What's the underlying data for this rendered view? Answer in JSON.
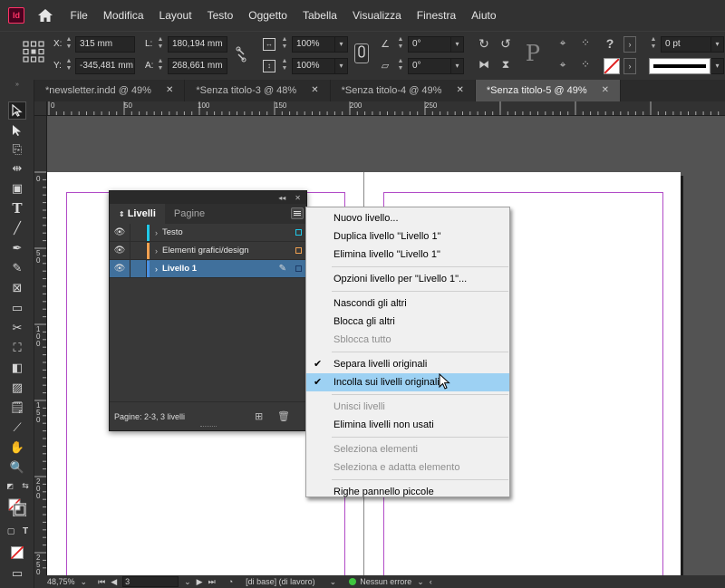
{
  "app": {
    "logo_text": "Id"
  },
  "menubar": {
    "items": [
      "File",
      "Modifica",
      "Layout",
      "Testo",
      "Oggetto",
      "Tabella",
      "Visualizza",
      "Finestra",
      "Aiuto"
    ]
  },
  "controlbar": {
    "x_label": "X:",
    "x_value": "315 mm",
    "y_label": "Y:",
    "y_value": "-345,481 mm",
    "l_label": "L:",
    "l_value": "180,194 mm",
    "a_label": "A:",
    "a_value": "268,661 mm",
    "scale_x": "100%",
    "scale_y": "100%",
    "angle_rotate": "0°",
    "angle_shear": "0°",
    "stroke_weight": "0 pt"
  },
  "tabs": [
    {
      "label": "*newsletter.indd @ 49%",
      "close": "✕",
      "active": false
    },
    {
      "label": "*Senza titolo-3 @ 48%",
      "close": "✕",
      "active": false
    },
    {
      "label": "*Senza titolo-4 @ 49%",
      "close": "✕",
      "active": false
    },
    {
      "label": "*Senza titolo-5 @ 49%",
      "close": "✕",
      "active": true
    }
  ],
  "ruler_h": [
    "0",
    "50",
    "100",
    "150",
    "200",
    "250"
  ],
  "ruler_v": [
    "0",
    "50",
    "100",
    "150",
    "200",
    "250"
  ],
  "layers_panel": {
    "tabs": [
      "Livelli",
      "Pagine"
    ],
    "layers": [
      {
        "name": "Testo",
        "color": "#20c8e8",
        "selected": false
      },
      {
        "name": "Elementi grafici/design",
        "color": "#f0a050",
        "selected": false
      },
      {
        "name": "Livello 1",
        "color": "#4a90e2",
        "selected": true
      }
    ],
    "footer_text": "Pagine: 2-3, 3 livelli"
  },
  "context_menu": {
    "items": [
      {
        "label": "Nuovo livello...",
        "type": "item"
      },
      {
        "label": "Duplica livello \"Livello 1\"",
        "type": "item"
      },
      {
        "label": "Elimina livello \"Livello 1\"",
        "type": "item"
      },
      {
        "type": "sep"
      },
      {
        "label": "Opzioni livello per \"Livello 1\"...",
        "type": "item"
      },
      {
        "type": "sep"
      },
      {
        "label": "Nascondi gli altri",
        "type": "item"
      },
      {
        "label": "Blocca gli altri",
        "type": "item"
      },
      {
        "label": "Sblocca tutto",
        "type": "item",
        "disabled": true
      },
      {
        "type": "sep"
      },
      {
        "label": "Separa livelli originali",
        "type": "item",
        "checked": true
      },
      {
        "label": "Incolla sui livelli originali",
        "type": "item",
        "checked": true,
        "highlight": true
      },
      {
        "type": "sep"
      },
      {
        "label": "Unisci livelli",
        "type": "item",
        "disabled": true
      },
      {
        "label": "Elimina livelli non usati",
        "type": "item"
      },
      {
        "type": "sep"
      },
      {
        "label": "Seleziona elementi",
        "type": "item",
        "disabled": true
      },
      {
        "label": "Seleziona e adatta elemento",
        "type": "item",
        "disabled": true
      },
      {
        "type": "sep"
      },
      {
        "label": "Righe pannello piccole",
        "type": "item"
      }
    ]
  },
  "statusbar": {
    "zoom": "48,75%",
    "page": "3",
    "master": "[di base] (di lavoro)",
    "preflight": "Nessun errore",
    "preflight_color": "#3ec43e"
  }
}
